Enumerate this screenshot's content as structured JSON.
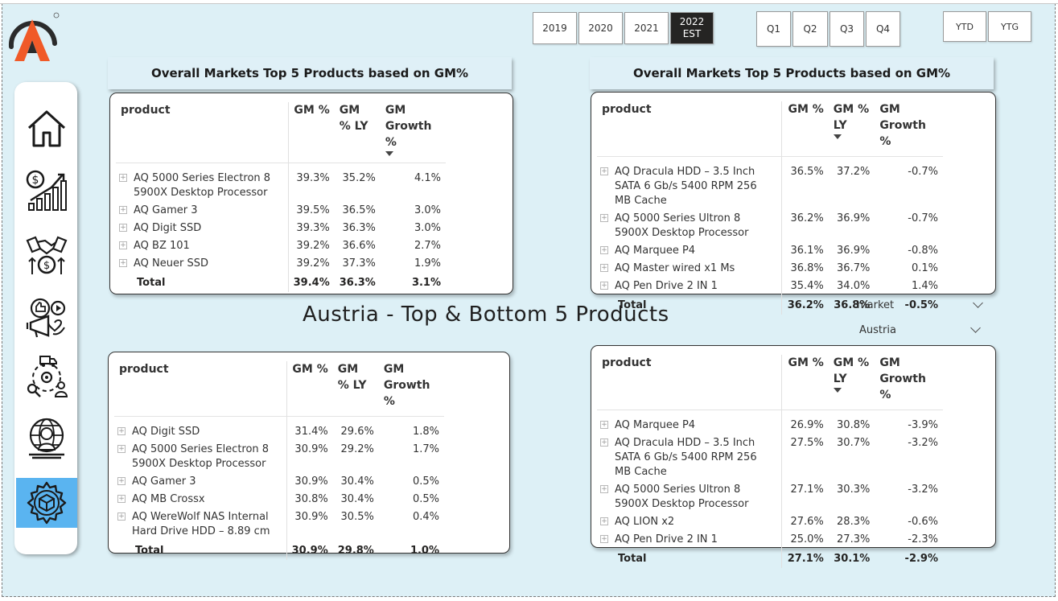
{
  "logo": {
    "name": "brand-logo",
    "accent_orange": "#f05a28",
    "dark": "#2b2b2b"
  },
  "colors": {
    "canvas_bg": "#ddf0f6",
    "active_nav": "#5ab4f0",
    "selected_slicer": "#252423"
  },
  "nav": [
    {
      "icon": "home-icon"
    },
    {
      "icon": "finance-growth-icon"
    },
    {
      "icon": "handshake-deal-icon"
    },
    {
      "icon": "marketing-megaphone-icon"
    },
    {
      "icon": "supply-chain-icon"
    },
    {
      "icon": "global-support-icon"
    },
    {
      "icon": "product-settings-icon",
      "active": true
    }
  ],
  "year_slicer": [
    "2019",
    "2020",
    "2021",
    "2022\nEST"
  ],
  "year_selected": "2022\nEST",
  "quarter_slicer": [
    "Q1",
    "Q2",
    "Q3",
    "Q4"
  ],
  "ytd_slicer": [
    "YTD",
    "YTG"
  ],
  "page_title": "Austria - Top & Bottom 5 Products",
  "filter": {
    "label": "market",
    "value": "Austria"
  },
  "headers": {
    "product": "product",
    "gm": "GM %",
    "gm_ly_a": "GM",
    "gm_ly_b": "% LY",
    "growth_a": "GM",
    "growth_b": "Growth %",
    "gm_ly_r1": "GM %",
    "gm_ly_r2": "LY"
  },
  "top_left": {
    "title": "Overall Markets Top 5 Products based on GM%",
    "rows": [
      {
        "product": "AQ 5000 Series Electron 8 5900X Desktop Processor",
        "gm": "39.3%",
        "gm_ly": "35.2%",
        "growth": "4.1%"
      },
      {
        "product": "AQ Gamer 3",
        "gm": "39.5%",
        "gm_ly": "36.5%",
        "growth": "3.0%"
      },
      {
        "product": "AQ Digit SSD",
        "gm": "39.3%",
        "gm_ly": "36.3%",
        "growth": "3.0%"
      },
      {
        "product": "AQ BZ 101",
        "gm": "39.2%",
        "gm_ly": "36.6%",
        "growth": "2.7%"
      },
      {
        "product": "AQ Neuer SSD",
        "gm": "39.2%",
        "gm_ly": "37.3%",
        "growth": "1.9%"
      }
    ],
    "total": {
      "label": "Total",
      "gm": "39.4%",
      "gm_ly": "36.3%",
      "growth": "3.1%"
    }
  },
  "top_right": {
    "title": "Overall Markets Top 5 Products based on GM%",
    "rows": [
      {
        "product": "AQ Dracula HDD – 3.5 Inch SATA 6 Gb/s 5400 RPM 256 MB Cache",
        "gm": "36.5%",
        "gm_ly": "37.2%",
        "growth": "-0.7%"
      },
      {
        "product": "AQ 5000 Series Ultron 8 5900X Desktop Processor",
        "gm": "36.2%",
        "gm_ly": "36.9%",
        "growth": "-0.7%"
      },
      {
        "product": "AQ Marquee P4",
        "gm": "36.1%",
        "gm_ly": "36.9%",
        "growth": "-0.8%"
      },
      {
        "product": "AQ Master wired x1 Ms",
        "gm": "36.8%",
        "gm_ly": "36.7%",
        "growth": "0.1%"
      },
      {
        "product": "AQ Pen Drive 2 IN 1",
        "gm": "35.4%",
        "gm_ly": "34.0%",
        "growth": "1.4%"
      }
    ],
    "total": {
      "label": "Total",
      "gm": "36.2%",
      "gm_ly": "36.8%",
      "growth": "-0.5%"
    }
  },
  "bottom_left": {
    "rows": [
      {
        "product": "AQ Digit SSD",
        "gm": "31.4%",
        "gm_ly": "29.6%",
        "growth": "1.8%"
      },
      {
        "product": "AQ 5000 Series Electron 8 5900X Desktop Processor",
        "gm": "30.9%",
        "gm_ly": "29.2%",
        "growth": "1.7%"
      },
      {
        "product": "AQ Gamer 3",
        "gm": "30.9%",
        "gm_ly": "30.4%",
        "growth": "0.5%"
      },
      {
        "product": "AQ MB Crossx",
        "gm": "30.8%",
        "gm_ly": "30.4%",
        "growth": "0.5%"
      },
      {
        "product": "AQ WereWolf NAS Internal Hard Drive HDD – 8.89 cm",
        "gm": "30.9%",
        "gm_ly": "30.5%",
        "growth": "0.4%"
      }
    ],
    "total": {
      "label": "Total",
      "gm": "30.9%",
      "gm_ly": "29.8%",
      "growth": "1.0%"
    }
  },
  "bottom_right": {
    "rows": [
      {
        "product": "AQ Marquee P4",
        "gm": "26.9%",
        "gm_ly": "30.8%",
        "growth": "-3.9%"
      },
      {
        "product": "AQ Dracula HDD – 3.5 Inch SATA 6 Gb/s 5400 RPM 256 MB Cache",
        "gm": "27.5%",
        "gm_ly": "30.7%",
        "growth": "-3.2%"
      },
      {
        "product": "AQ 5000 Series Ultron 8 5900X Desktop Processor",
        "gm": "27.1%",
        "gm_ly": "30.3%",
        "growth": "-3.2%"
      },
      {
        "product": "AQ LION x2",
        "gm": "27.6%",
        "gm_ly": "28.3%",
        "growth": "-0.6%"
      },
      {
        "product": "AQ Pen Drive 2 IN 1",
        "gm": "25.0%",
        "gm_ly": "27.3%",
        "growth": "-2.3%"
      }
    ],
    "total": {
      "label": "Total",
      "gm": "27.1%",
      "gm_ly": "30.1%",
      "growth": "-2.9%"
    }
  }
}
